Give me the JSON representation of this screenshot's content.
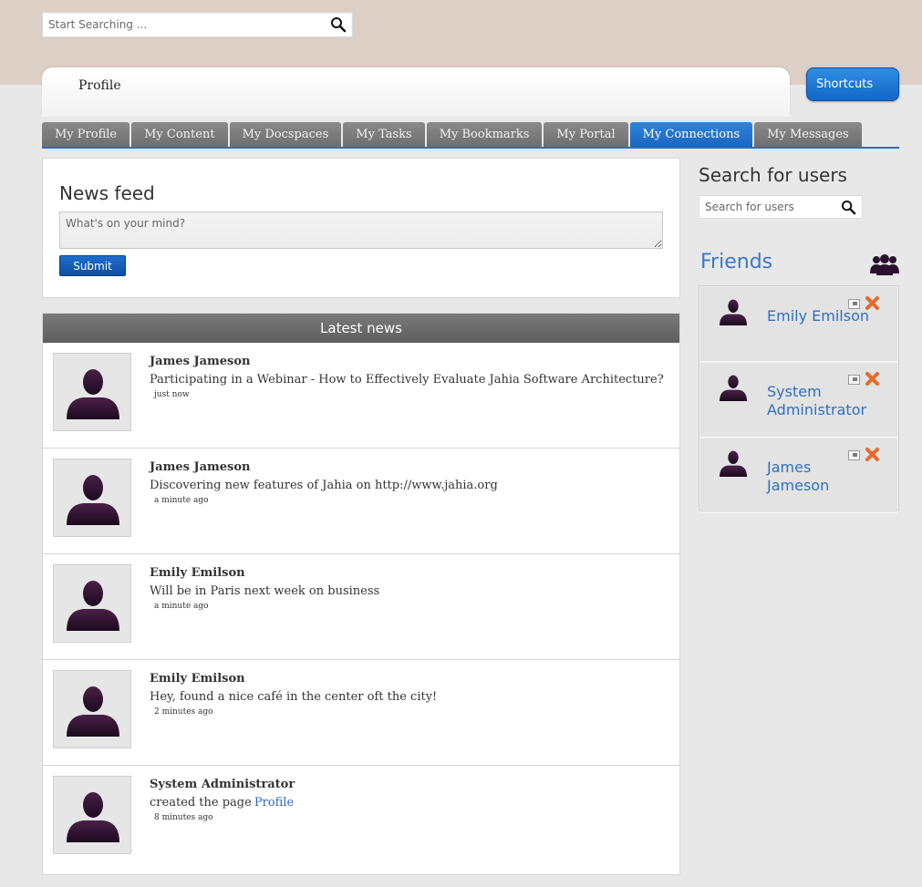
{
  "header": {
    "search_placeholder": "Start Searching ...",
    "page_title": "Profile",
    "shortcuts_label": "Shortcuts"
  },
  "tabs": [
    {
      "label": "My Profile",
      "active": false
    },
    {
      "label": "My Content",
      "active": false
    },
    {
      "label": "My Docspaces",
      "active": false
    },
    {
      "label": "My Tasks",
      "active": false
    },
    {
      "label": "My Bookmarks",
      "active": false
    },
    {
      "label": "My Portal",
      "active": false
    },
    {
      "label": "My Connections",
      "active": true
    },
    {
      "label": "My Messages",
      "active": false
    }
  ],
  "newsfeed": {
    "title": "News feed",
    "placeholder": "What's on your mind?",
    "submit_label": "Submit"
  },
  "latest": {
    "title": "Latest news",
    "items": [
      {
        "author": "James Jameson",
        "text": "Participating in a Webinar - How to Effectively Evaluate Jahia Software Architecture?",
        "link": "",
        "time": "just now"
      },
      {
        "author": "James Jameson",
        "text": "Discovering new features of Jahia on http://www.jahia.org",
        "link": "",
        "time": "a minute ago"
      },
      {
        "author": "Emily Emilson",
        "text": "Will be in Paris next week on business",
        "link": "",
        "time": "a minute ago"
      },
      {
        "author": "Emily Emilson",
        "text": "Hey, found a nice café in the center oft the city!",
        "link": "",
        "time": "2 minutes ago"
      },
      {
        "author": "System Administrator",
        "text": "created the page",
        "link": "Profile",
        "time": "8 minutes ago"
      }
    ]
  },
  "sidebar": {
    "search_title": "Search for users",
    "search_placeholder": "Search for users",
    "friends_title": "Friends",
    "friends": [
      {
        "name": "Emily Emilson"
      },
      {
        "name": "System Administrator"
      },
      {
        "name": "James Jameson"
      }
    ]
  },
  "colors": {
    "top_band": "#dcd0c6",
    "page_bg": "#e8e8e8",
    "active_tab": "#1f6fc6",
    "link_blue": "#2f6fc4",
    "avatar_fill": "#2b1030",
    "remove_orange": "#e8692a"
  },
  "icons": {
    "search": "magnifier-icon",
    "avatar": "user-silhouette-icon",
    "group": "user-group-icon",
    "message": "envelope-icon",
    "remove": "remove-x-icon"
  }
}
